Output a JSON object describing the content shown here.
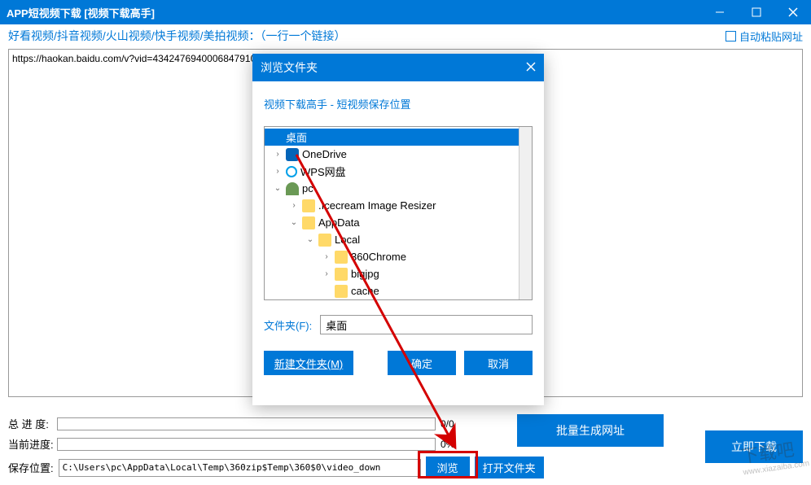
{
  "window": {
    "title": "APP短视频下载 [视频下载高手]"
  },
  "toolbar": {
    "label": "好看视频/抖音视频/火山视频/快手视频/美拍视频：（一行一个链接）",
    "auto_paste": "自动粘贴网址"
  },
  "url_input": "https://haokan.baidu.com/v?vid=4342476940006847910",
  "progress": {
    "total_label": "总 进 度:",
    "total_val": "0/0",
    "current_label": "当前进度:",
    "current_val": "0%"
  },
  "buttons": {
    "batch": "批量生成网址",
    "download": "立即下载",
    "browse": "浏览",
    "open_folder": "打开文件夹"
  },
  "save": {
    "label": "保存位置:",
    "path": "C:\\Users\\pc\\AppData\\Local\\Temp\\360zip$Temp\\360$0\\video_down"
  },
  "dialog": {
    "title": "浏览文件夹",
    "desc": "视频下载高手 - 短视频保存位置",
    "folder_label": "文件夹(F):",
    "folder_value": "桌面",
    "btn_new": "新建文件夹",
    "btn_new_key": "(M)",
    "btn_ok": "确定",
    "btn_cancel": "取消",
    "tree": {
      "desktop": "桌面",
      "onedrive": "OneDrive",
      "wps": "WPS网盘",
      "pc": "pc",
      "icecream": ".Icecream Image Resizer",
      "appdata": "AppData",
      "local": "Local",
      "chrome360": "360Chrome",
      "bigjpg": "bigjpg",
      "cache": "cache"
    }
  }
}
